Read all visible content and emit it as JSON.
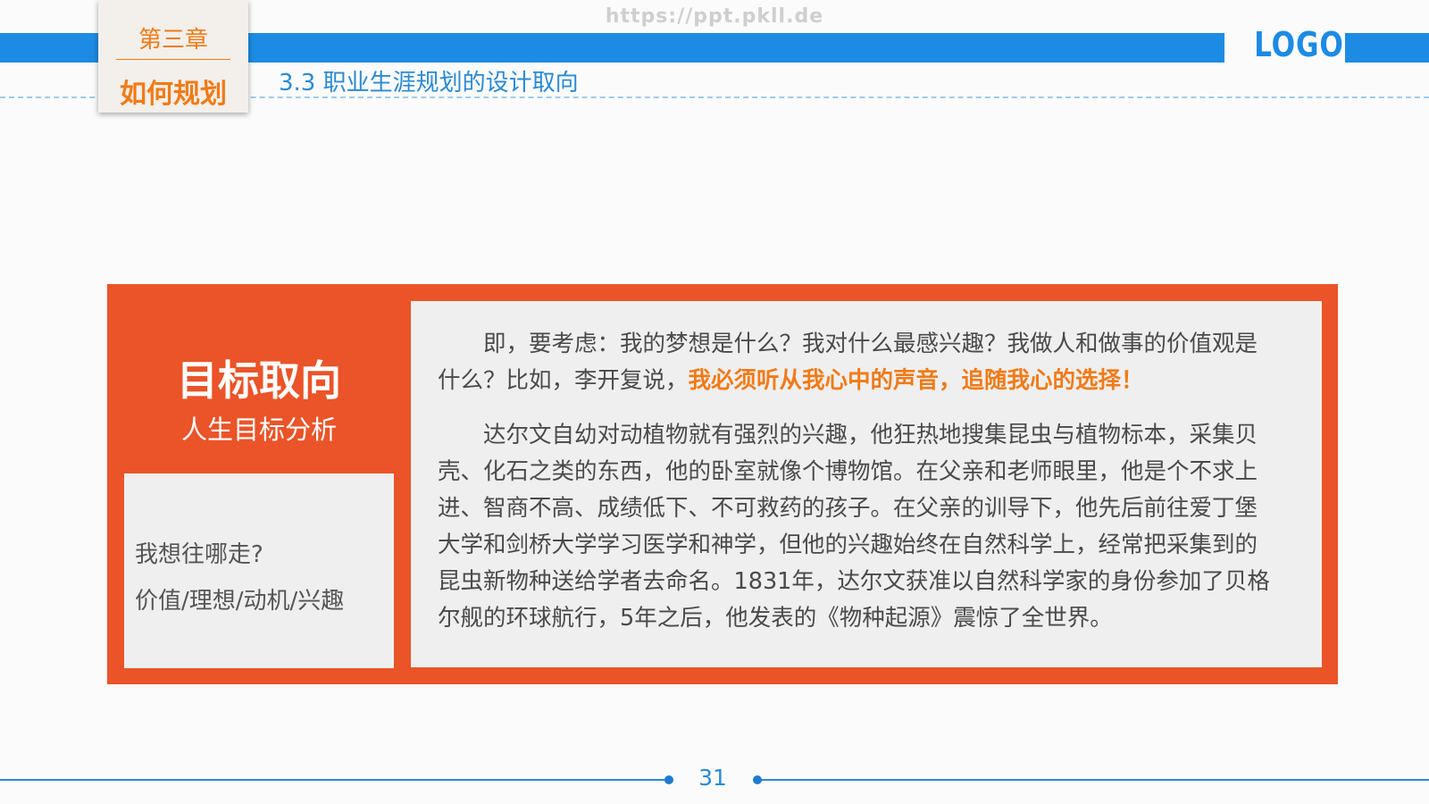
{
  "watermark": "https://ppt.pkll.de",
  "logo": "LOGO",
  "chapter": {
    "number_label": "第三章",
    "title": "如何规划"
  },
  "section_title": "3.3 职业生涯规划的设计取向",
  "card": {
    "heading": "目标取向",
    "subheading": "人生目标分析",
    "questions": [
      "我想往哪走?",
      "价值/理想/动机/兴趣"
    ],
    "paragraph1_plain": "即，要考虑：我的梦想是什么？我对什么最感兴趣？我做人和做事的价值观是什么？比如，李开复说，",
    "paragraph1_highlight": "我必须听从我心中的声音，追随我心的选择！",
    "paragraph2": "达尔文自幼对动植物就有强烈的兴趣，他狂热地搜集昆虫与植物标本，采集贝壳、化石之类的东西，他的卧室就像个博物馆。在父亲和老师眼里，他是个不求上进、智商不高、成绩低下、不可救药的孩子。在父亲的训导下，他先后前往爱丁堡大学和剑桥大学学习医学和神学，但他的兴趣始终在自然科学上，经常把采集到的昆虫新物种送给学者去命名。1831年，达尔文获准以自然科学家的身份参加了贝格尔舰的环球航行，5年之后，他发表的《物种起源》震惊了全世界。"
  },
  "page_number": "31",
  "colors": {
    "primary_blue": "#1d8be3",
    "accent_orange": "#ea5428",
    "highlight_orange": "#f07b17"
  }
}
